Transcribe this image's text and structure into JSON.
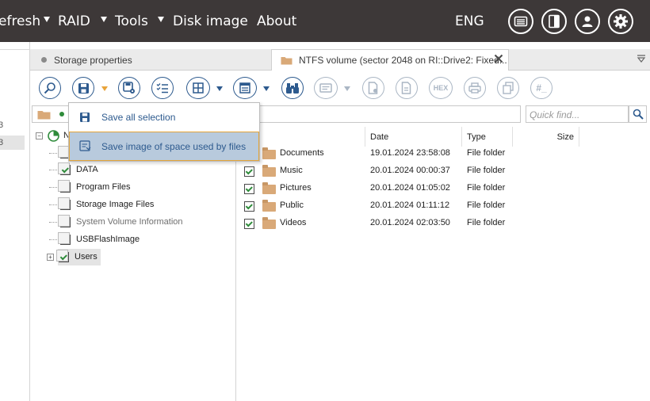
{
  "topmenu": {
    "items": [
      "efresh",
      "RAID",
      "Tools",
      "Disk image",
      "About"
    ],
    "language": "ENG"
  },
  "leftstrip": {
    "items": [
      "3",
      "3"
    ]
  },
  "tabs": [
    {
      "label": "Storage properties"
    },
    {
      "label": "NTFS volume (sector 2048 on RI::Drive2: Fixed..."
    }
  ],
  "toolbar": {
    "hex_label": "HEX",
    "hash_label": "#_"
  },
  "search": {
    "placeholder": "Quick find..."
  },
  "dropdown": {
    "items": [
      {
        "label": "Save all selection"
      },
      {
        "label": "Save image of space used by files"
      }
    ]
  },
  "tree": {
    "root_label": "N",
    "items": [
      {
        "label": "DATA",
        "checked": true
      },
      {
        "label": "Program Files",
        "checked": false
      },
      {
        "label": "Storage Image Files",
        "checked": false
      },
      {
        "label": "System Volume Information",
        "checked": false
      },
      {
        "label": "USBFlashImage",
        "checked": false
      },
      {
        "label": "Users",
        "checked": true
      }
    ]
  },
  "list": {
    "columns": {
      "name": "e",
      "date": "Date",
      "type": "Type",
      "size": "Size"
    },
    "rows": [
      {
        "name": "Documents",
        "date": "19.01.2024 23:58:08",
        "type": "File folder"
      },
      {
        "name": "Music",
        "date": "20.01.2024 00:00:37",
        "type": "File folder"
      },
      {
        "name": "Pictures",
        "date": "20.01.2024 01:05:02",
        "type": "File folder"
      },
      {
        "name": "Public",
        "date": "20.01.2024 01:11:12",
        "type": "File folder"
      },
      {
        "name": "Videos",
        "date": "20.01.2024 02:03:50",
        "type": "File folder"
      }
    ]
  },
  "colors": {
    "topbar": "#3d3838",
    "accent": "#2d5a8e",
    "highlight": "#b8cadd",
    "highlight_border": "#e3a53a",
    "check": "#2e8b3a"
  }
}
